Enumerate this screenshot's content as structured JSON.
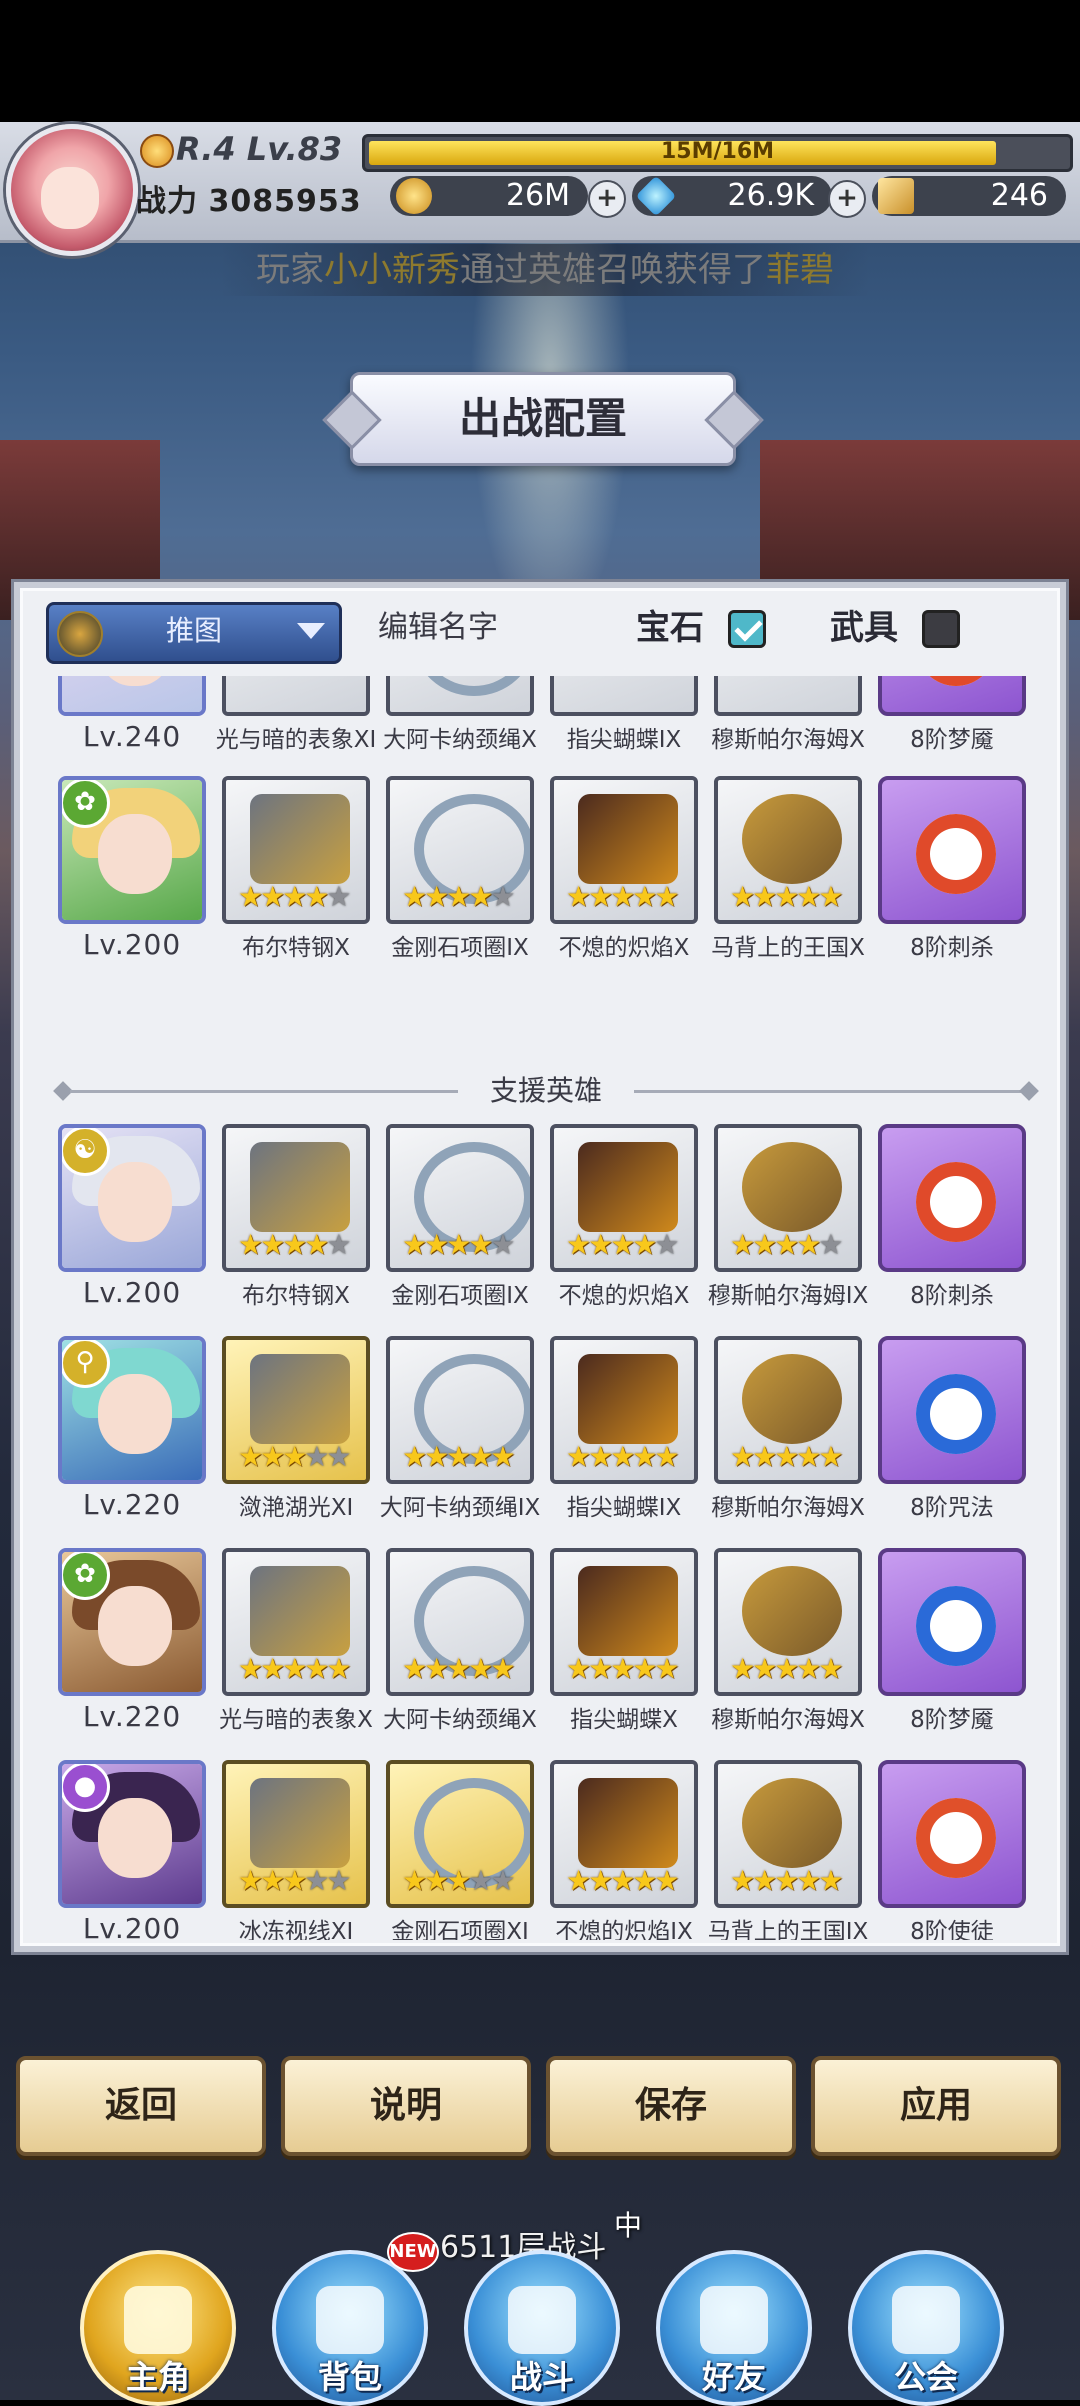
{
  "player": {
    "rank_level": "R.4 Lv.83",
    "exp_text": "15M/16M",
    "exp_fraction": 0.94,
    "power_label": "战力",
    "power_value": "3085953"
  },
  "currency": {
    "gold": "26M",
    "gems": "26.9K",
    "tickets": "246",
    "plus": "+"
  },
  "marquee": {
    "prefix": "玩家",
    "player": "小小新秀",
    "middle": "通过英雄召唤获得了",
    "hero": "菲碧"
  },
  "title": "出战配置",
  "panel": {
    "dropdown_value": "推图",
    "edit_name": "编辑名字",
    "gem_label": "宝石",
    "gem_checked": true,
    "weapon_label": "武具",
    "weapon_checked": false,
    "support_header": "支援英雄"
  },
  "rows": [
    {
      "level": "Lv.240",
      "items": [
        "光与暗的表象XI",
        "大阿卡纳颈绳X",
        "指尖蝴蝶IX",
        "穆斯帕尔海姆X",
        "8阶梦魇"
      ]
    },
    {
      "level": "Lv.200",
      "class_icon": "leaf-icon",
      "items": [
        "布尔特钢X",
        "金刚石项圈IX",
        "不熄的炽焰X",
        "马背上的王国X",
        "8阶刺杀"
      ],
      "stars": [
        4,
        4,
        5,
        5
      ]
    },
    {
      "level": "Lv.200",
      "class_icon": "swirl-icon",
      "items": [
        "布尔特钢X",
        "金刚石项圈IX",
        "不熄的炽焰X",
        "穆斯帕尔海姆IX",
        "8阶刺杀"
      ],
      "stars": [
        4,
        4,
        4,
        4
      ]
    },
    {
      "level": "Lv.220",
      "class_icon": "magnifier-icon",
      "items": [
        "潋滟湖光XI",
        "大阿卡纳颈绳IX",
        "指尖蝴蝶IX",
        "穆斯帕尔海姆X",
        "8阶咒法"
      ],
      "stars": [
        3,
        5,
        5,
        5
      ]
    },
    {
      "level": "Lv.220",
      "class_icon": "leaf-icon",
      "items": [
        "光与暗的表象X",
        "大阿卡纳颈绳X",
        "指尖蝴蝶X",
        "穆斯帕尔海姆X",
        "8阶梦魇"
      ],
      "stars": [
        5,
        5,
        5,
        5
      ]
    },
    {
      "level": "Lv.200",
      "class_icon": "orb-icon",
      "items": [
        "冰冻视线XI",
        "金刚石项圈XI",
        "不熄的炽焰IX",
        "马背上的王国IX",
        "8阶使徒"
      ],
      "stars": [
        3,
        3,
        5,
        5
      ]
    }
  ],
  "buttons": {
    "back": "返回",
    "help": "说明",
    "save": "保存",
    "apply": "应用"
  },
  "battle_status": {
    "floor": "6511层战斗",
    "state": "中"
  },
  "nav": {
    "hero": "主角",
    "bag": "背包",
    "battle": "战斗",
    "friends": "好友",
    "guild": "公会",
    "new_badge": "NEW"
  }
}
